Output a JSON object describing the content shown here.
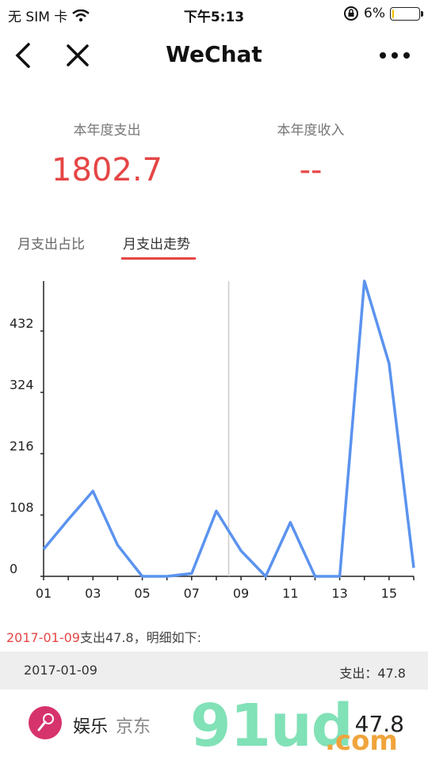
{
  "status_bar": {
    "carrier": "无 SIM 卡",
    "time": "下午5:13",
    "battery": "6%",
    "battery_level": 0.06
  },
  "nav": {
    "title": "WeChat",
    "back_icon": "chevron-left-icon",
    "close_icon": "close-icon",
    "more_icon": "more-dots-icon"
  },
  "summary": {
    "expense_label": "本年度支出",
    "expense_value": "1802.7",
    "income_label": "本年度收入",
    "income_value": "--"
  },
  "tabs": [
    {
      "label": "月支出占比",
      "active": false
    },
    {
      "label": "月支出走势",
      "active": true
    }
  ],
  "chart_data": {
    "type": "line",
    "x": [
      1,
      2,
      3,
      4,
      5,
      6,
      7,
      8,
      9,
      10,
      11,
      12,
      13,
      14,
      15,
      16
    ],
    "x_tick_labels": [
      "01",
      "03",
      "05",
      "07",
      "09",
      "11",
      "13",
      "15"
    ],
    "y_tick_labels": [
      "0",
      "108",
      "216",
      "324",
      "432"
    ],
    "ylim": [
      0,
      520
    ],
    "series": [
      {
        "values": [
          47.8,
          100,
          150,
          55,
          0,
          0,
          5,
          115,
          45,
          0,
          95,
          0,
          0,
          520,
          375,
          15
        ],
        "color": "#5b93ef"
      }
    ]
  },
  "detail": {
    "date": "2017-01-09",
    "summary_text": "支出47.8，明细如下:",
    "bar_date": "2017-01-09",
    "bar_amount": "支出：47.8",
    "item": {
      "category": "娱乐",
      "merchant": "京东",
      "amount": "47.8",
      "icon": "microphone-icon"
    }
  },
  "watermark": {
    "main": "91ud",
    "sub": ".com"
  }
}
